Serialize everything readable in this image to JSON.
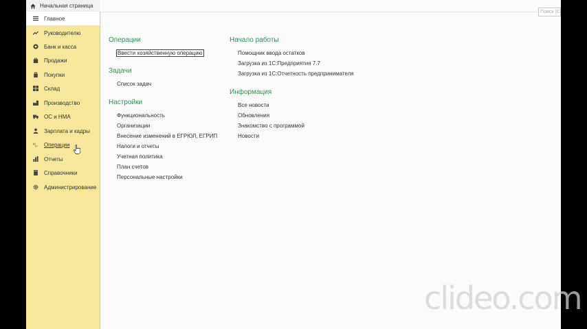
{
  "header": {
    "home_tab_label": "Начальная страница",
    "search_placeholder": "Поиск (Ctrl+F)"
  },
  "sidebar": {
    "items": [
      {
        "label": "Главное",
        "icon": "menu-lines-icon"
      },
      {
        "label": "Руководителю",
        "icon": "trend-up-icon"
      },
      {
        "label": "Банк и касса",
        "icon": "coin-icon"
      },
      {
        "label": "Продажи",
        "icon": "shopping-bag-icon"
      },
      {
        "label": "Покупки",
        "icon": "basket-icon"
      },
      {
        "label": "Склад",
        "icon": "warehouse-grid-icon"
      },
      {
        "label": "Производство",
        "icon": "factory-icon"
      },
      {
        "label": "ОС и НМА",
        "icon": "truck-icon"
      },
      {
        "label": "Зарплата и кадры",
        "icon": "person-icon"
      },
      {
        "label": "Операции",
        "icon": "dt-kt-icon"
      },
      {
        "label": "Отчеты",
        "icon": "bar-chart-icon"
      },
      {
        "label": "Справочники",
        "icon": "book-icon"
      },
      {
        "label": "Администрирование",
        "icon": "gear-icon"
      }
    ],
    "active_index": 0,
    "hovered_index": 9
  },
  "main": {
    "operations": {
      "title": "Операции",
      "links": [
        "Ввести хозяйственную операцию"
      ]
    },
    "tasks": {
      "title": "Задачи",
      "links": [
        "Список задач"
      ]
    },
    "settings": {
      "title": "Настройки",
      "links": [
        "Функциональность",
        "Организации",
        "Внесение изменений в ЕГРЮЛ, ЕГРИП",
        "Налоги и отчеты",
        "Учетная политика",
        "План счетов",
        "Персональные настройки"
      ]
    },
    "getting_started": {
      "title": "Начало работы",
      "links": [
        "Помощник ввода остатков",
        "Загрузка из 1С:Предприятия 7.7",
        "Загрузка из 1С:Отчетность предпринимателя"
      ]
    },
    "info": {
      "title": "Информация",
      "links": [
        "Все новости",
        "Обновления",
        "Знакомство с программой",
        "Новости"
      ]
    }
  },
  "watermark": "clideo.com",
  "colors": {
    "sidebar_bg": "#f6e79a",
    "group_title": "#2f8f5a",
    "page_bg": "#fbfbf9"
  }
}
